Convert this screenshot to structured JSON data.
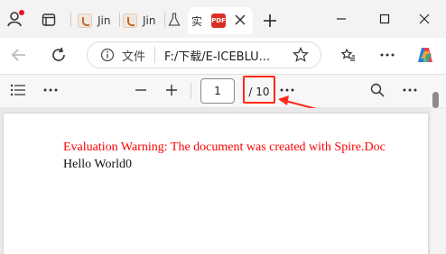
{
  "tabs": [
    {
      "label": "Jin"
    },
    {
      "label": "Jin"
    },
    {
      "label": ""
    },
    {
      "label": "实"
    }
  ],
  "address_bar": {
    "site_label": "文件",
    "url": "F:/下载/E-ICEBLU..."
  },
  "pdf_toolbar": {
    "current_page": "1",
    "page_total": "/ 10"
  },
  "document": {
    "warning": "Evaluation Warning: The document was created with Spire.Doc",
    "body": "Hello World0"
  },
  "colors": {
    "warning_text": "#ff0000",
    "annotation": "#ff2a17"
  },
  "icons": [
    "avatar-icon",
    "tab-actions-icon",
    "beaker-icon",
    "close-icon",
    "plus-icon",
    "minimize-icon",
    "maximize-icon",
    "back-icon",
    "refresh-icon",
    "info-icon",
    "favorite-star-icon",
    "collections-icon",
    "more-icon",
    "copilot-icon",
    "contents-list-icon",
    "zoom-out-icon",
    "zoom-in-icon",
    "search-icon"
  ]
}
